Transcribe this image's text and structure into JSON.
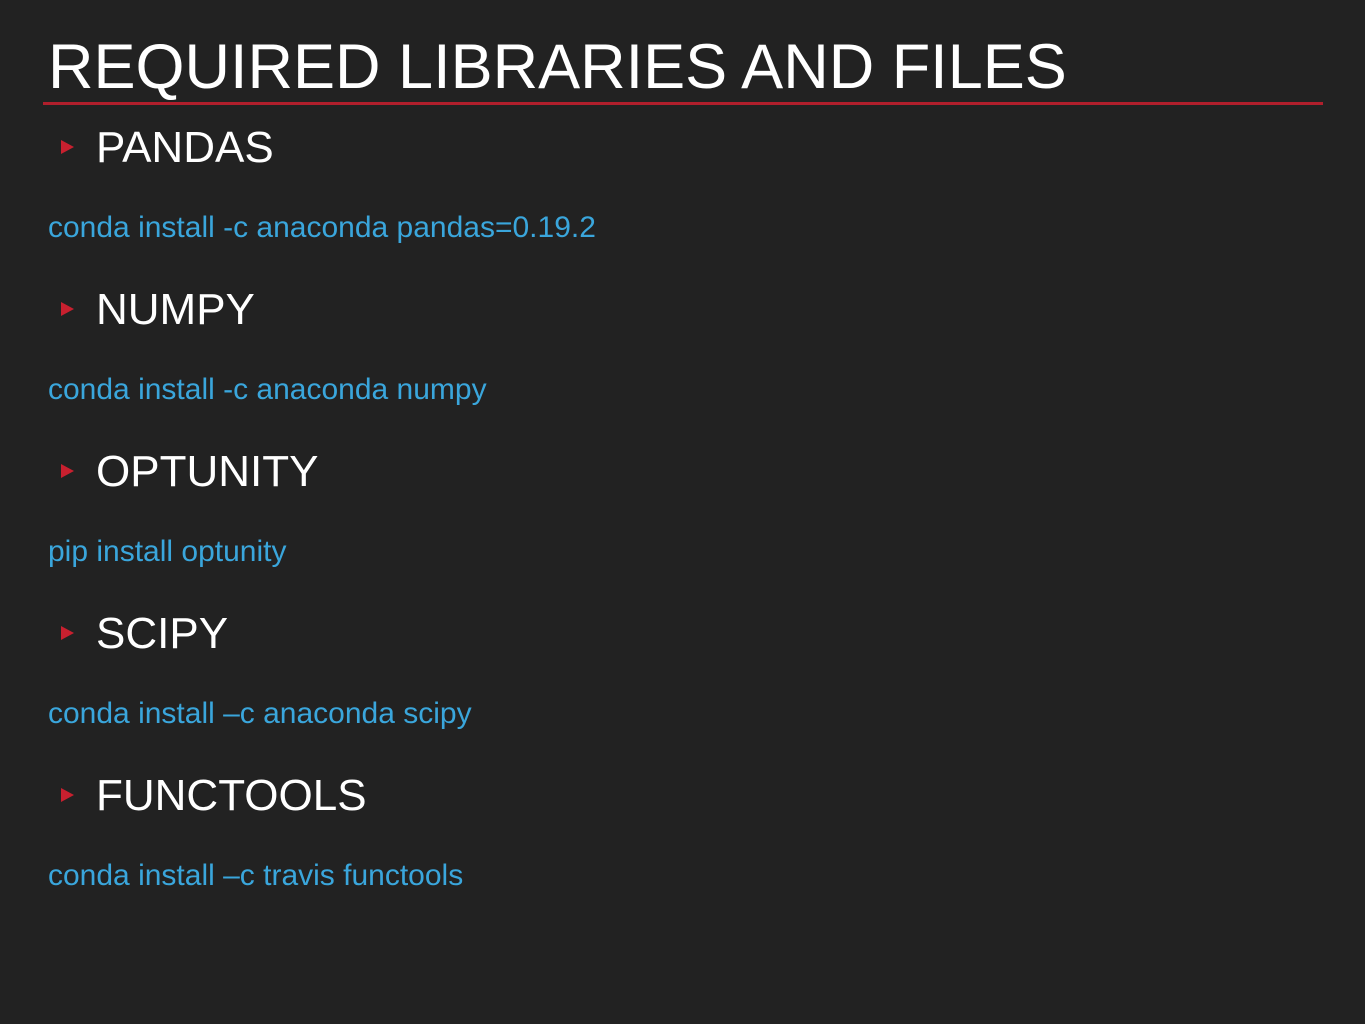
{
  "slide": {
    "title": "REQUIRED LIBRARIES AND FILES",
    "colors": {
      "background": "#222222",
      "title": "#ffffff",
      "accent_rule": "#b01f2c",
      "bullet": "#c8202f",
      "command": "#3aa6dc"
    },
    "bullet_icon": "triangle-right-icon",
    "items": [
      {
        "heading": "PANDAS",
        "command": "conda install -c anaconda pandas=0.19.2"
      },
      {
        "heading": "NUMPY",
        "command": "conda install -c anaconda numpy"
      },
      {
        "heading": "OPTUNITY",
        "command": "pip install optunity"
      },
      {
        "heading": "SCIPY",
        "command": "conda install –c anaconda scipy"
      },
      {
        "heading": "FUNCTOOLS",
        "command": "conda install –c travis functools"
      }
    ]
  }
}
